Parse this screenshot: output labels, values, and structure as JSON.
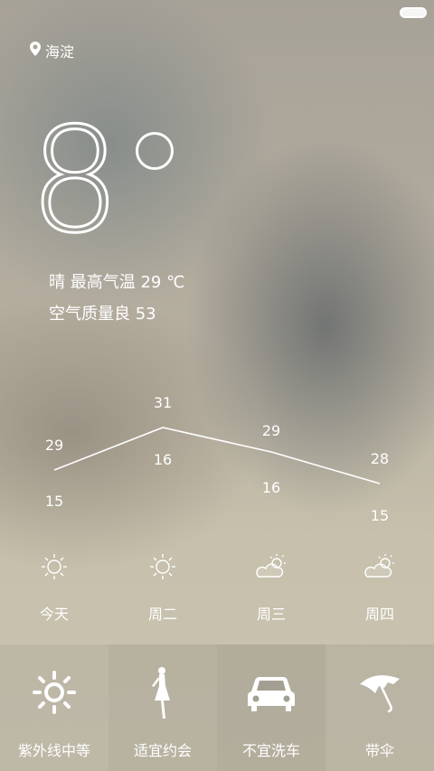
{
  "location": {
    "name": "海淀",
    "icon": "location-pin-icon"
  },
  "current": {
    "temp": "8",
    "condition_line": "晴  最高气温 29 ℃",
    "aqi_line": "空气质量良 53"
  },
  "chart_data": {
    "type": "line",
    "categories": [
      "今天",
      "周二",
      "周三",
      "周四"
    ],
    "series": [
      {
        "name": "",
        "values": [
          29,
          31,
          29,
          28
        ]
      },
      {
        "name": "",
        "values": [
          15,
          16,
          16,
          15
        ]
      }
    ],
    "high_labels": [
      "29",
      "31",
      "29",
      "28"
    ],
    "low_labels": [
      "15",
      "16",
      "16",
      "15"
    ]
  },
  "forecast": [
    {
      "label": "今天",
      "icon": "sun-icon"
    },
    {
      "label": "周二",
      "icon": "sun-icon"
    },
    {
      "label": "周三",
      "icon": "partly-cloudy-icon"
    },
    {
      "label": "周四",
      "icon": "partly-cloudy-icon"
    }
  ],
  "tips": [
    {
      "label": "紫外线中等",
      "icon": "sun-icon"
    },
    {
      "label": "适宜约会",
      "icon": "woman-figure-icon"
    },
    {
      "label": "不宜洗车",
      "icon": "car-icon"
    },
    {
      "label": "带伞",
      "icon": "umbrella-icon"
    }
  ]
}
